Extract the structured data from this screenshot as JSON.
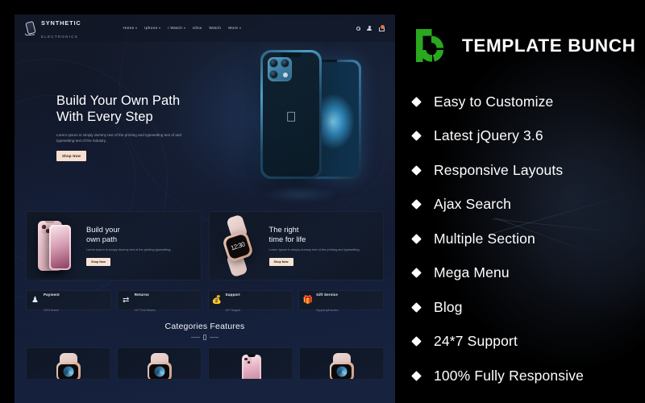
{
  "preview": {
    "header": {
      "brand_name": "SYNTHETIC",
      "brand_sub": "ELECTRONICS",
      "brand_icon": "phone-outline-icon",
      "nav": [
        {
          "label": "Home",
          "has_caret": true
        },
        {
          "label": "Iphone",
          "has_caret": true
        },
        {
          "label": "I Watch",
          "has_caret": true
        },
        {
          "label": "Ultra",
          "has_caret": false
        },
        {
          "label": "Watch",
          "has_caret": false
        },
        {
          "label": "More",
          "has_caret": true
        }
      ],
      "icons": [
        "search-icon",
        "user-icon",
        "cart-icon"
      ]
    },
    "hero": {
      "title_line1": "Build Your Own Path",
      "title_line2": "With Every Step",
      "description": "Lorem Ipsum is simply dummy text of the printing and typesetting text of and typesetting text of the industry.",
      "button": "Shop Now",
      "product_image": "blue-iphone-12-pro"
    },
    "promos": [
      {
        "title_line1": "Build your",
        "title_line2": "own path",
        "description": "Lorem Ipsum is simply dummy text of the printing typesetting.",
        "button": "Shop Now",
        "image": "pink-iphone"
      },
      {
        "title_line1": "The right",
        "title_line2": "time for life",
        "description": "Lorem Ipsum is simply dummy text of the printing and typesetting.",
        "button": "Shop Now",
        "image": "rose-gold-smartwatch",
        "watch_time": "12:30"
      }
    ],
    "services": [
      {
        "icon": "payment-icon",
        "name": "Payment",
        "sub": "100% Secure"
      },
      {
        "icon": "returns-icon",
        "name": "Returns",
        "sub": "14*7 Free Returns"
      },
      {
        "icon": "support-icon",
        "name": "Support",
        "sub": "24*7 Support"
      },
      {
        "icon": "gift-icon",
        "name": "Gift Service",
        "sub": "Support gift service"
      }
    ],
    "categories": {
      "title": "Categories Features"
    },
    "products": [
      {
        "image": "smartwatch-silver"
      },
      {
        "image": "smartwatch-dark-dial"
      },
      {
        "image": "pink-iphone-front"
      },
      {
        "image": "smartwatch-sport"
      }
    ]
  },
  "features_panel": {
    "logo_mark": "template-bunch-logo",
    "logo_text": "TEMPLATE BUNCH",
    "accent_color": "#2aa81f",
    "bullet_icon": "diamond-bullet-icon",
    "items": [
      {
        "label": "Easy to Customize"
      },
      {
        "label": "Latest jQuery 3.6"
      },
      {
        "label": "Responsive Layouts"
      },
      {
        "label": "Ajax Search"
      },
      {
        "label": "Multiple Section"
      },
      {
        "label": "Mega Menu"
      },
      {
        "label": "Blog"
      },
      {
        "label": "24*7 Support"
      },
      {
        "label": "100% Fully Responsive"
      }
    ]
  }
}
